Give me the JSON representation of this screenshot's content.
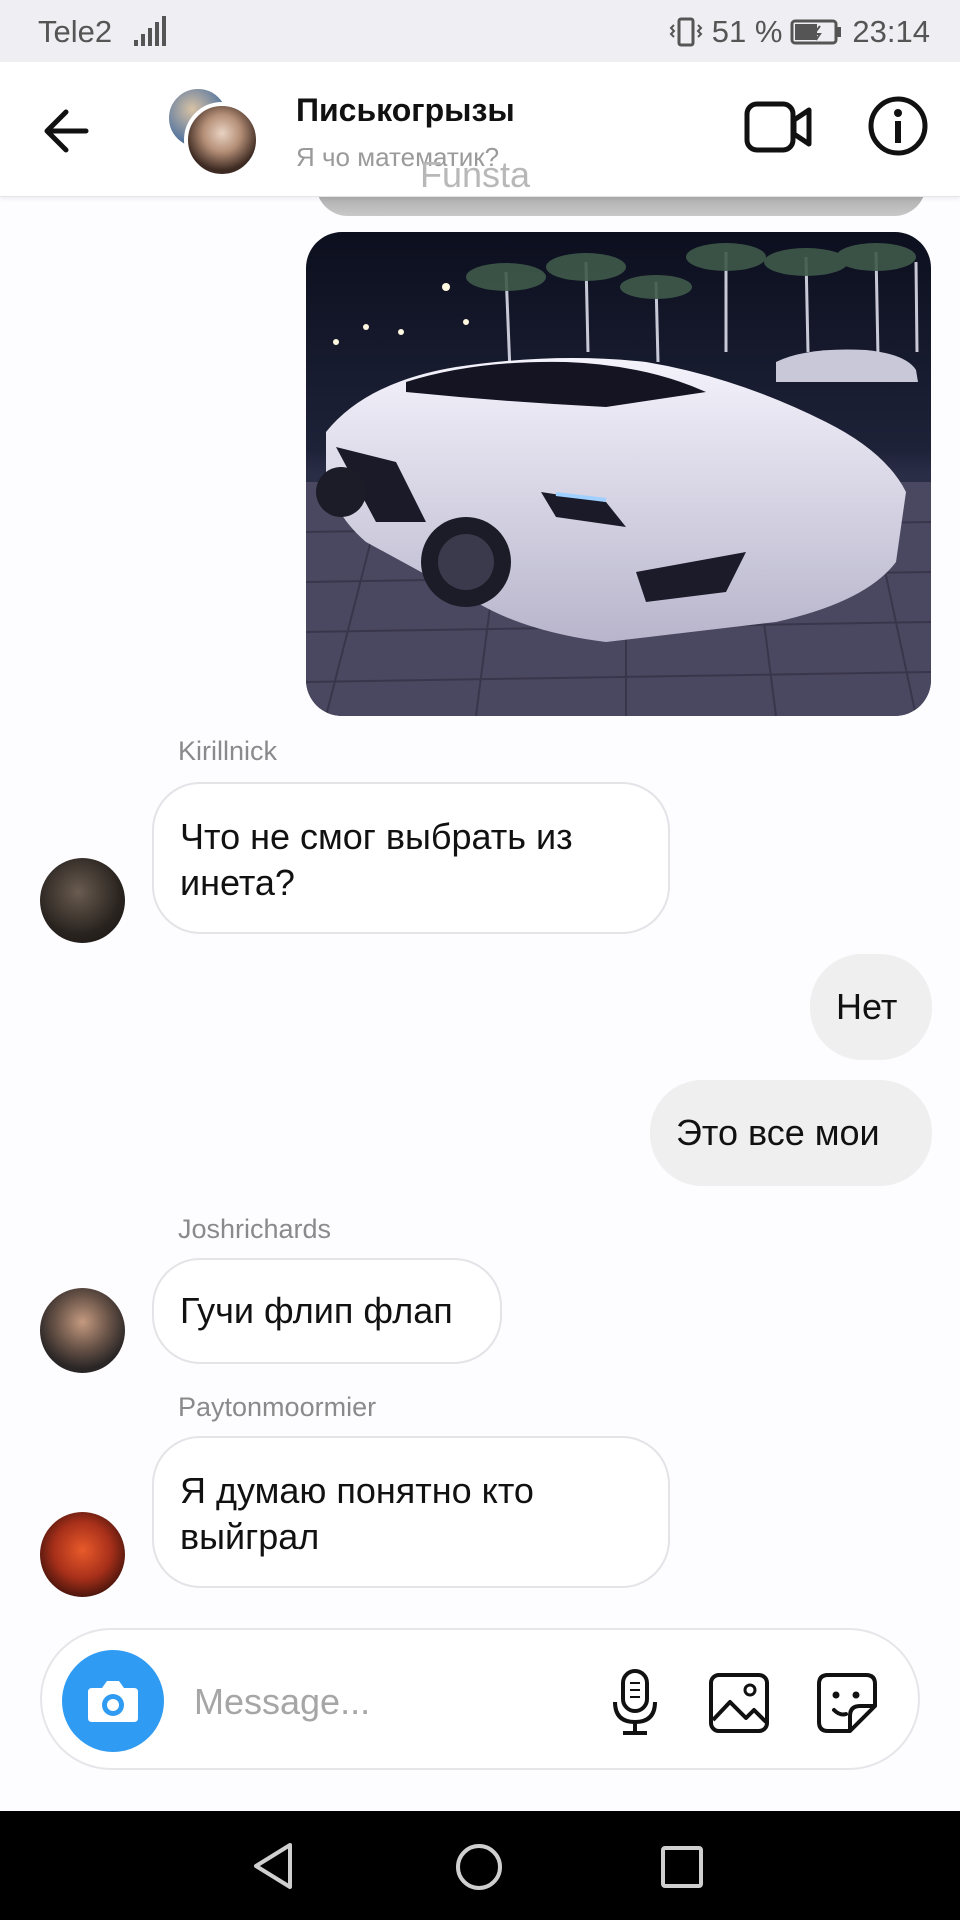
{
  "status_bar": {
    "carrier": "Tele2",
    "battery": "51 %",
    "time": "23:14"
  },
  "header": {
    "title": "Писькогрызы",
    "subtitle": "Я чо математик?",
    "watermark": "Funsta"
  },
  "messages": [
    {
      "sender": "Kirillnick",
      "text": "Что не смог выбрать из инета?"
    },
    {
      "outgoing": true,
      "text": "Нет"
    },
    {
      "outgoing": true,
      "text": "Это все мои"
    },
    {
      "sender": "Joshrichards",
      "text": "Гучи флип флап"
    },
    {
      "sender": "Paytonmoormier",
      "text": "Я думаю понятно кто выйграл"
    }
  ],
  "composer": {
    "placeholder": "Message..."
  },
  "icons": {
    "back": "arrow-left-icon",
    "video": "video-camera-icon",
    "info": "info-icon",
    "camera": "camera-icon",
    "mic": "microphone-icon",
    "gallery": "image-icon",
    "sticker": "sticker-icon"
  },
  "colors": {
    "accent": "#2f9bf2",
    "outgoing_bubble": "#efefef",
    "incoming_border": "#e3e3e8"
  }
}
